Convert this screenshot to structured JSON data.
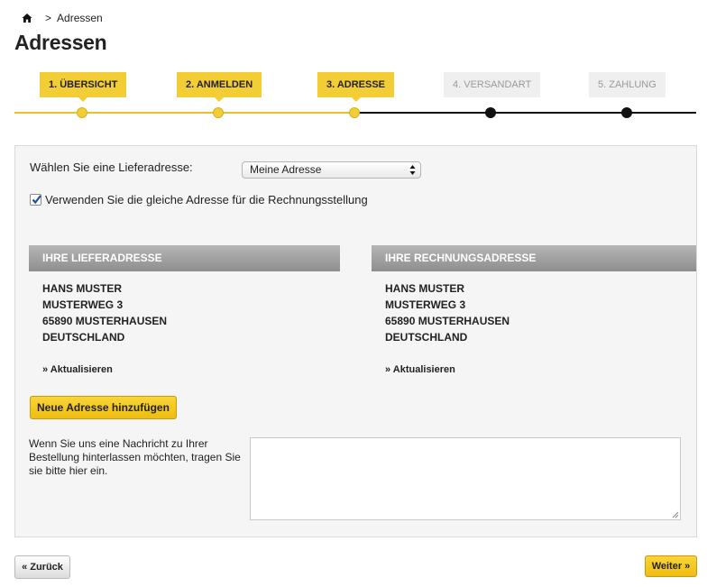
{
  "breadcrumb": {
    "home_icon": "home-icon",
    "separator": ">",
    "current": "Adressen"
  },
  "page": {
    "title": "Adressen"
  },
  "steps": [
    {
      "label": "1. ÜBERSICHT",
      "state": "done"
    },
    {
      "label": "2. ANMELDEN",
      "state": "done"
    },
    {
      "label": "3. ADRESSE",
      "state": "current"
    },
    {
      "label": "4. VERSANDART",
      "state": "todo"
    },
    {
      "label": "5. ZAHLUNG",
      "state": "todo"
    }
  ],
  "form": {
    "delivery_label": "Wählen Sie eine Lieferadresse:",
    "delivery_selected": "Meine Adresse",
    "same_address_label": "Verwenden Sie die gleiche Adresse für die Rechnungsstellung",
    "same_address_checked": true
  },
  "delivery_address": {
    "heading": "IHRE LIEFERADRESSE",
    "lines": [
      "HANS MUSTER",
      "MUSTERWEG 3",
      "65890 MUSTERHAUSEN",
      "DEUTSCHLAND"
    ],
    "update_link": "» Aktualisieren"
  },
  "billing_address": {
    "heading": "IHRE RECHNUNGSADRESSE",
    "lines": [
      "HANS MUSTER",
      "MUSTERWEG 3",
      "65890 MUSTERHAUSEN",
      "DEUTSCHLAND"
    ],
    "update_link": "» Aktualisieren"
  },
  "add_address_button": "Neue Adresse hinzufügen",
  "message": {
    "label": "Wenn Sie uns eine Nachricht zu Ihrer Bestellung hinterlassen möchten, tragen Sie sie bitte hier ein.",
    "value": ""
  },
  "nav": {
    "back_label": "« Zurück",
    "next_label": "Weiter »"
  },
  "colors": {
    "accent": "#f2cd35",
    "inactive_step": "#efefef",
    "header_gray": "#9e9e9e",
    "progress_todo": "#111111"
  }
}
